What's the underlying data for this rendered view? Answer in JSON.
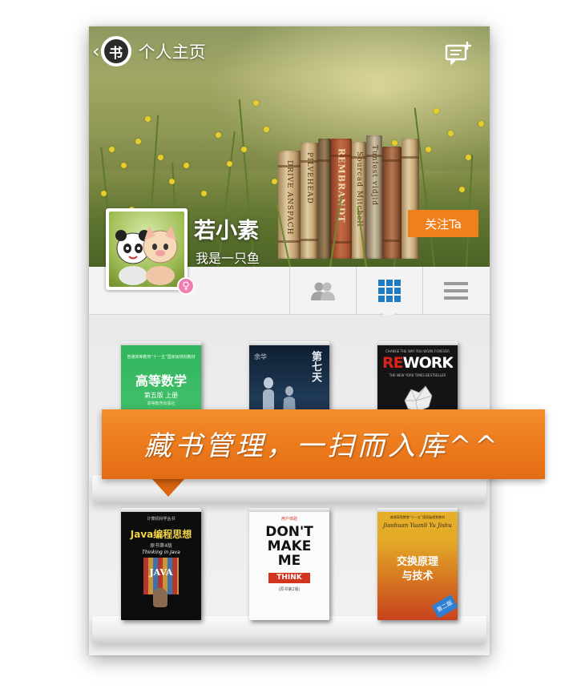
{
  "header": {
    "back_chevron": "‹",
    "logo_glyph": "书",
    "title": "个人主页",
    "message_icon": "message-add-icon"
  },
  "profile": {
    "username": "若小素",
    "signature": "我是一只鱼",
    "gender_symbol": "♀",
    "points": "10",
    "follow_label": "关注Ta"
  },
  "tabs": [
    {
      "icon": "friends-icon",
      "selected": false
    },
    {
      "icon": "grid-icon",
      "selected": true
    },
    {
      "icon": "list-icon",
      "selected": false
    }
  ],
  "photo_book_spines": [
    "DRIVE ANSPACH",
    "PILVEHEAD",
    "REMBRANDT",
    "Sourcad Mitchell",
    "Tunlest vidjid"
  ],
  "bookshelf": {
    "row1": [
      {
        "series": "普通高等教育“十一五”国家级规划教材",
        "title": "高等数学",
        "edition": "第五版 上册",
        "publisher": "高等教育出版社"
      },
      {
        "author": "余华",
        "title": "第七天"
      },
      {
        "top_line": "CHANGE THE WAY YOU WORK FOREVER",
        "title_red": "RE",
        "title_white": "WORK",
        "subtitle": "THE NEW YORK TIMES BESTSELLER"
      }
    ],
    "row2": [
      {
        "series": "计算机科学丛书",
        "title": "Java编程思想",
        "subtitle": "Thinking in Java",
        "edition": "原书第4版",
        "cover_word": "JAVA"
      },
      {
        "top_line": "用户体验",
        "line1": "DON'T",
        "line2": "MAKE",
        "line3": "ME",
        "line4": "THINK",
        "edition": "(原书第2版)"
      },
      {
        "series": "普通高等教育“十一五”国家级规划教材",
        "author_en": "Jiaohuan Yuanli Yu Jishu",
        "title_line1": "交换原理",
        "title_line2": "与技术",
        "edition_badge": "第二版"
      }
    ]
  },
  "banner": {
    "text": "藏书管理，一扫而入库^^"
  },
  "colors": {
    "accent_orange": "#f0801c",
    "banner_orange": "#ec7a1c",
    "tab_active_blue": "#1f7bc2",
    "tab_inactive_gray": "#9a9a9a",
    "gender_pink": "#f07cb0"
  }
}
